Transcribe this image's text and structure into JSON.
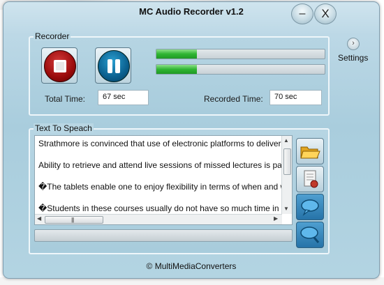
{
  "window": {
    "title": "MC Audio Recorder v1.2",
    "minimize_label": "–",
    "close_label": "X"
  },
  "recorder": {
    "group_label": "Recorder",
    "meter_levels": [
      0.24,
      0.24
    ],
    "total_time_label": "Total Time:",
    "total_time_value": "67 sec",
    "recorded_time_label": "Recorded Time:",
    "recorded_time_value": "70 sec"
  },
  "settings": {
    "arrow": "›",
    "label": "Settings"
  },
  "tts": {
    "group_label": "Text To Speach",
    "lines": [
      "Strathmore is convinced that use of electronic platforms to deliver",
      "Ability to retrieve and attend live sessions of missed lectures is par",
      "�The tablets enable one to enjoy flexibility in terms of when and w",
      "�Students in these courses usually do not have so much time in th"
    ],
    "scroll": {
      "up": "▲",
      "down": "▼",
      "left": "◀",
      "right": "▶",
      "grip": "|||"
    }
  },
  "footer": {
    "copyright": "© MultiMediaConverters"
  },
  "colors": {
    "window_bg": "#a9cddd",
    "meter_fill": "#2fb532",
    "stop_button": "#9a0b0b",
    "pause_button": "#0a5f8e"
  },
  "icons": [
    "stop-icon",
    "pause-icon",
    "open-folder-icon",
    "open-document-icon",
    "speak-icon",
    "speak-search-icon",
    "chevron-right-icon"
  ]
}
